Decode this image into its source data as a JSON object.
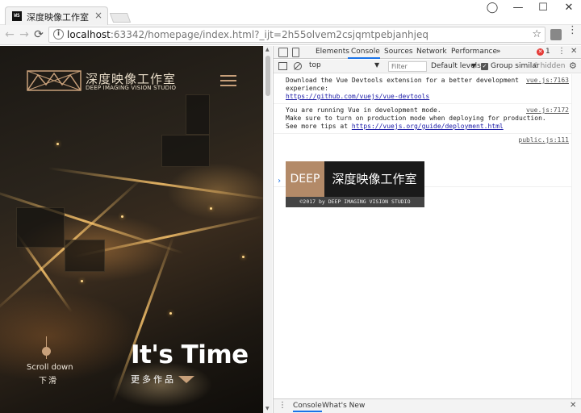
{
  "window": {
    "tab_title": "深度映像工作室",
    "tab_favicon": "WS",
    "tab_close": "×",
    "controls": {
      "user": "◯",
      "minimize": "—",
      "maximize": "☐",
      "close": "✕"
    }
  },
  "addressbar": {
    "back": "←",
    "forward": "→",
    "reload": "⟳",
    "info": "i",
    "url_host": "localhost",
    "url_rest": ":63342/homepage/index.html?_ijt=2h55olvem2csjqmtpebjanhjeq",
    "star": "☆",
    "menu": "⋮"
  },
  "website": {
    "logo_cn": "深度映像工作室",
    "logo_en": "DEEP IMAGING VISION STUDIO",
    "scroll_down": "Scroll down",
    "scroll_cn": "下滑",
    "hero": "It's Time",
    "more": "更多作品",
    "accent_color": "#c8a07a"
  },
  "devtools": {
    "tabs": [
      "Elements",
      "Console",
      "Sources",
      "Network",
      "Performance"
    ],
    "active_tab": "Console",
    "more_tabs": "»",
    "error_count": "1",
    "dots": "⋮",
    "close": "✕",
    "toolbar": {
      "context": "top",
      "filter_placeholder": "Filter",
      "levels": "Default levels",
      "group_similar": "Group similar",
      "hidden": "6 hidden",
      "gear": "⚙",
      "check": "✓",
      "arrow": "▼"
    },
    "messages": [
      {
        "text": "Download the Vue Devtools extension for a better development\nexperience:",
        "link": "https://github.com/vuejs/vue-devtools",
        "source": "vue.js:7163"
      },
      {
        "text": "You are running Vue in development mode.\nMake sure to turn on production mode when deploying for production.\nSee more tips at ",
        "link": "https://vuejs.org/guide/deployment.html",
        "source": "vue.js:7172"
      }
    ],
    "banner": {
      "source": "public.js:111",
      "deep": "DEEP",
      "cn": "深度映像工作室",
      "foot": "©2017 by DEEP IMAGING VISION STUDIO"
    },
    "prompt": "›",
    "drawer": {
      "menu": "⋮",
      "tabs": [
        "Console",
        "What's New"
      ],
      "close": "✕"
    }
  }
}
